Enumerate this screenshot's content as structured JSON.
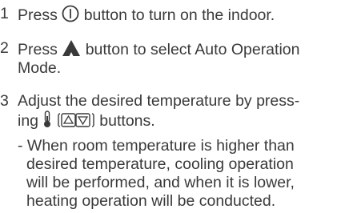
{
  "steps": [
    {
      "number": "1",
      "before": "Press",
      "icon": "power-icon",
      "after": "button to turn on the indoor."
    },
    {
      "number": "2",
      "before": "Press",
      "icon": "auto-mode-icon",
      "after": "button to select Auto Operation",
      "line2": "Mode."
    },
    {
      "number": "3",
      "line1": "Adjust the desired temperature by press-",
      "line2_before": "ing",
      "icons": [
        "thermometer-icon",
        "up-arrow-button-icon",
        "down-arrow-button-icon"
      ],
      "line2_after": "buttons."
    }
  ],
  "note": {
    "lines": [
      "- When room temperature is higher than",
      "desired temperature, cooling operation",
      "will be performed, and when it is lower,",
      "heating operation will be conducted."
    ]
  }
}
